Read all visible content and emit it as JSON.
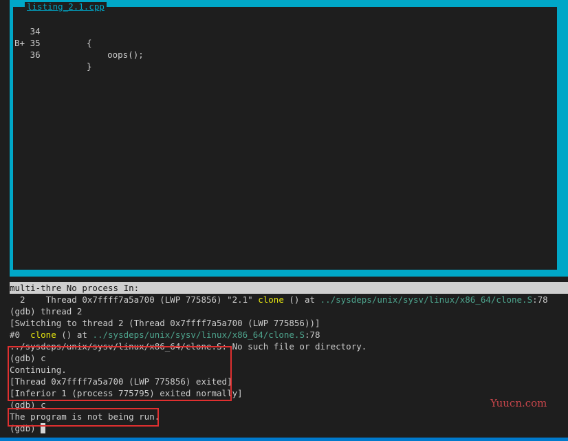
{
  "tui": {
    "title": "listing_2.1.cpp",
    "source_lines": [
      {
        "gutter": "   34",
        "code": "{"
      },
      {
        "gutter": "B+ 35",
        "code": "    oops();"
      },
      {
        "gutter": "   36",
        "code": "}"
      }
    ]
  },
  "status_bar": {
    "text": "multi-thre No process In:"
  },
  "terminal": {
    "line1": {
      "a": "  2    Thread 0x7ffff7a5a700 (LWP 775856) \"2.1\" ",
      "func": "clone",
      "b": " () at ",
      "path": "../sysdeps/unix/sysv/linux/x86_64/clone.S",
      "c": ":78"
    },
    "line2": "(gdb) thread 2",
    "line3": "[Switching to thread 2 (Thread 0x7ffff7a5a700 (LWP 775856))]",
    "line4": {
      "a": "#0  ",
      "func": "clone",
      "b": " () at ",
      "path": "../sysdeps/unix/sysv/linux/x86_64/clone.S",
      "c": ":78"
    },
    "line5": "../sysdeps/unix/sysv/linux/x86_64/clone.S: No such file or directory.",
    "line6": "(gdb) c",
    "line7": "Continuing.",
    "line8": "[Thread 0x7ffff7a5a700 (LWP 775856) exited]",
    "line9": "[Inferior 1 (process 775795) exited normally]",
    "line10": "(gdb) c",
    "line11": "The program is not being run.",
    "line12": "(gdb) "
  },
  "watermark": "Yuucn.com",
  "colors": {
    "tui_border": "#00a7c7",
    "highlight_box": "#e03030",
    "function_name": "#e5e510",
    "path": "#4ea58e"
  }
}
